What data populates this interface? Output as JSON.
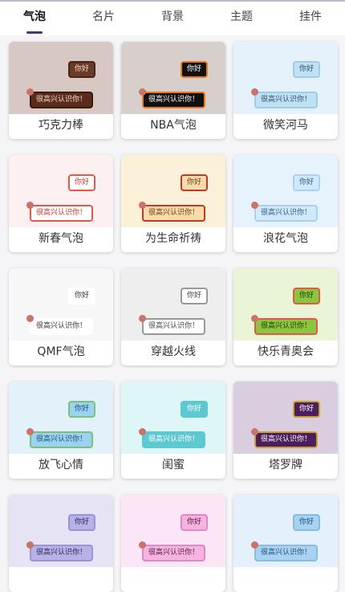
{
  "tabs": [
    "气泡",
    "名片",
    "背景",
    "主题",
    "挂件"
  ],
  "active_tab": 0,
  "preview_text": {
    "short": "你好",
    "long": "很高兴认识你！"
  },
  "cards": [
    {
      "name": "巧克力棒",
      "bg": "#d7c8c3",
      "b1": {
        "bg": "#6b3a2a",
        "fg": "#f2dcc8",
        "border": "#4a2418"
      },
      "b2": {
        "bg": "#5b2c1c",
        "fg": "#f2dcc8",
        "border": "#3c1a10"
      }
    },
    {
      "name": "NBA气泡",
      "bg": "#d6cfcb",
      "b1": {
        "bg": "#111111",
        "fg": "#ffffff",
        "border": "#ee7a1e"
      },
      "b2": {
        "bg": "#111111",
        "fg": "#ffffff",
        "border": "#ee7a1e"
      }
    },
    {
      "name": "微笑河马",
      "bg": "#e5f1fb",
      "b1": {
        "bg": "#bfe0f5",
        "fg": "#305070",
        "border": "#9fcde9"
      },
      "b2": {
        "bg": "#bfe0f5",
        "fg": "#305070",
        "border": "#9fcde9"
      }
    },
    {
      "name": "新春气泡",
      "bg": "#fdf0f0",
      "b1": {
        "bg": "#ffffff",
        "fg": "#c0392b",
        "border": "#e05a4c"
      },
      "b2": {
        "bg": "#ffffff",
        "fg": "#c0392b",
        "border": "#e05a4c"
      }
    },
    {
      "name": "为生命祈祷",
      "bg": "#fbf0d8",
      "b1": {
        "bg": "#f8dca8",
        "fg": "#6b3a1a",
        "border": "#c0392b"
      },
      "b2": {
        "bg": "#f8dca8",
        "fg": "#6b3a1a",
        "border": "#c0392b"
      }
    },
    {
      "name": "浪花气泡",
      "bg": "#e6f3fc",
      "b1": {
        "bg": "#d2e9fb",
        "fg": "#2a5a8a",
        "border": "#a9d2f2"
      },
      "b2": {
        "bg": "#d2e9fb",
        "fg": "#2a5a8a",
        "border": "#a9d2f2"
      }
    },
    {
      "name": "QMF气泡",
      "bg": "#f7f7f7",
      "b1": {
        "bg": "#ffffff",
        "fg": "#333333",
        "border": "#ffffff"
      },
      "b2": {
        "bg": "#ffffff",
        "fg": "#333333",
        "border": "#ffffff"
      }
    },
    {
      "name": "穿越火线",
      "bg": "#eeeeee",
      "b1": {
        "bg": "#ffffff",
        "fg": "#444444",
        "border": "#999999"
      },
      "b2": {
        "bg": "#ffffff",
        "fg": "#444444",
        "border": "#999999"
      }
    },
    {
      "name": "快乐青奥会",
      "bg": "#eaf5d8",
      "b1": {
        "bg": "#8cc63f",
        "fg": "#1f3b0a",
        "border": "#e05a4c"
      },
      "b2": {
        "bg": "#8cc63f",
        "fg": "#1f3b0a",
        "border": "#e05a4c"
      }
    },
    {
      "name": "放飞心情",
      "bg": "#e3f1fb",
      "b1": {
        "bg": "#9bd3ef",
        "fg": "#1f4f7a",
        "border": "#7cc07a"
      },
      "b2": {
        "bg": "#9bd3ef",
        "fg": "#1f4f7a",
        "border": "#7cc07a"
      }
    },
    {
      "name": "闺蜜",
      "bg": "#dff6f6",
      "b1": {
        "bg": "#5cc8d0",
        "fg": "#ffffff",
        "border": "#5cc8d0"
      },
      "b2": {
        "bg": "#5cc8d0",
        "fg": "#ffffff",
        "border": "#5cc8d0"
      }
    },
    {
      "name": "塔罗牌",
      "bg": "#d9cde0",
      "b1": {
        "bg": "#4b1e5e",
        "fg": "#ffffff",
        "border": "#c9a227"
      },
      "b2": {
        "bg": "#4b1e5e",
        "fg": "#ffffff",
        "border": "#c9a227"
      }
    },
    {
      "name": "",
      "bg": "#e6e3f4",
      "b1": {
        "bg": "#b7b2e6",
        "fg": "#2a2a5a",
        "border": "#9a93d6"
      },
      "b2": {
        "bg": "#b7b2e6",
        "fg": "#2a2a5a",
        "border": "#9a93d6"
      }
    },
    {
      "name": "",
      "bg": "#fae6f4",
      "b1": {
        "bg": "#f4b4de",
        "fg": "#5a1a4a",
        "border": "#e088c4"
      },
      "b2": {
        "bg": "#f4b4de",
        "fg": "#5a1a4a",
        "border": "#e088c4"
      }
    },
    {
      "name": "",
      "bg": "#e4f0fb",
      "b1": {
        "bg": "#a9d2f2",
        "fg": "#1f4f7a",
        "border": "#86bce6"
      },
      "b2": {
        "bg": "#a9d2f2",
        "fg": "#1f4f7a",
        "border": "#86bce6"
      }
    }
  ]
}
